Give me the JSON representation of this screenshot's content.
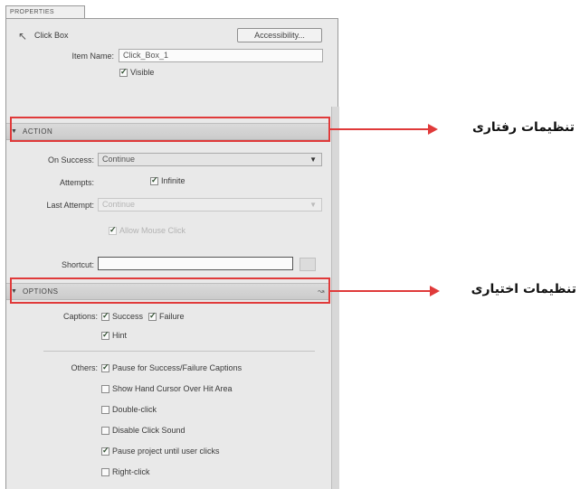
{
  "panel": {
    "tab_label": "PROPERTIES",
    "object_type": "Click Box",
    "accessibility_button": "Accessibility...",
    "item_name_label": "Item Name:",
    "item_name_value": "Click_Box_1",
    "visible_label": "Visible",
    "visible_checked": true
  },
  "action": {
    "header": "ACTION",
    "on_success_label": "On Success:",
    "on_success_value": "Continue",
    "attempts_label": "Attempts:",
    "infinite_label": "Infinite",
    "infinite_checked": true,
    "last_attempt_label": "Last Attempt:",
    "last_attempt_value": "Continue",
    "allow_mouse_click_label": "Allow Mouse Click",
    "shortcut_label": "Shortcut:",
    "shortcut_value": ""
  },
  "options": {
    "header": "OPTIONS",
    "captions_label": "Captions:",
    "captions": [
      {
        "label": "Success",
        "checked": true
      },
      {
        "label": "Failure",
        "checked": true
      },
      {
        "label": "Hint",
        "checked": true
      }
    ],
    "others_label": "Others:",
    "others": [
      {
        "label": "Pause for Success/Failure Captions",
        "checked": true
      },
      {
        "label": "Show Hand Cursor Over Hit Area",
        "checked": false
      },
      {
        "label": "Double-click",
        "checked": false
      },
      {
        "label": "Disable Click Sound",
        "checked": false
      },
      {
        "label": "Pause project until user clicks",
        "checked": true
      },
      {
        "label": "Right-click",
        "checked": false
      }
    ]
  },
  "annotations": {
    "behavior_settings": "تنظیمات رفتاری",
    "optional_settings": "تنظیمات اختیاری"
  },
  "colors": {
    "highlight": "#e03a3a",
    "panel_bg": "#e9e9e9"
  }
}
